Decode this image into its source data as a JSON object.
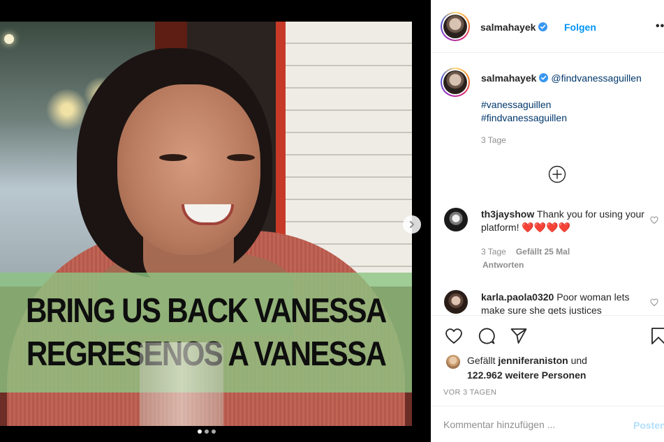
{
  "colors": {
    "accent": "#0095f6",
    "mention": "#00376b",
    "muted": "#8e8e8e",
    "banner": "#8cc482",
    "heart": "#ed4956"
  },
  "media": {
    "banner_lines": [
      "BRING US BACK VANESSA",
      "REGRESENOS A VANESSA"
    ],
    "carousel_dots": 3,
    "active_dot": 0,
    "next_icon": "chevron-right-icon"
  },
  "header": {
    "username": "salmahayek",
    "follow_label": "Folgen",
    "more_icon": "more-horizontal-icon"
  },
  "caption": {
    "username": "salmahayek",
    "mention": "@findvanessaguillen",
    "hashtags": [
      "#vanessaguillen",
      "#findvanessaguillen"
    ],
    "time": "3 Tage"
  },
  "load_more_icon": "plus-circle-icon",
  "comments": [
    {
      "username": "th3jayshow",
      "text": "Thank you for using your platform!",
      "emoji": "❤️❤️❤️❤️",
      "time": "3 Tage",
      "likes": "Gefällt 25 Mal",
      "reply_label": "Antworten"
    },
    {
      "username": "karla.paola0320",
      "text": "Poor woman lets make sure she gets justices"
    }
  ],
  "likes": {
    "prefix": "Gefällt",
    "liker": "jenniferaniston",
    "connector": "und",
    "others": "122.962 weitere Personen"
  },
  "post_age": "VOR 3 TAGEN",
  "comment_box": {
    "placeholder": "Kommentar hinzufügen ...",
    "post_label": "Posten"
  }
}
